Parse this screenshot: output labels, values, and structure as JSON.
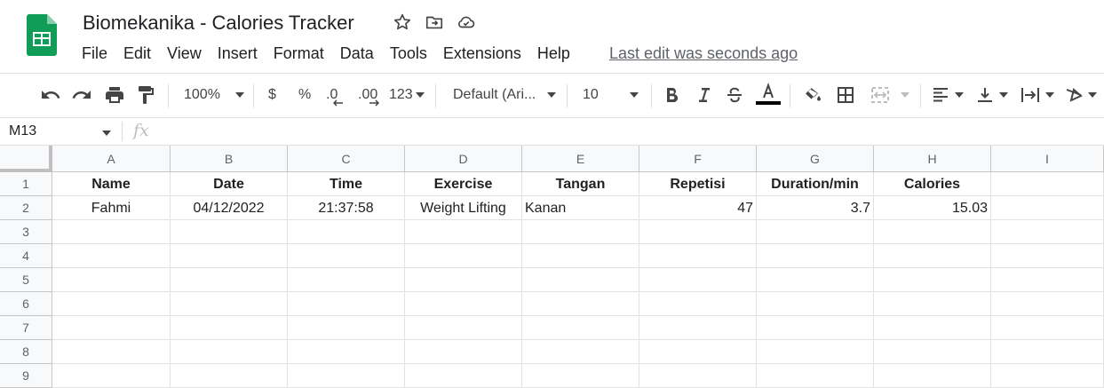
{
  "app": {
    "title": "Biomekanika - Calories Tracker",
    "last_edit": "Last edit was seconds ago",
    "brand_color": "#0F9D58"
  },
  "menu": [
    "File",
    "Edit",
    "View",
    "Insert",
    "Format",
    "Data",
    "Tools",
    "Extensions",
    "Help"
  ],
  "toolbar": {
    "zoom": "100%",
    "currency": "$",
    "percent": "%",
    "decrease_decimals": ".0",
    "increase_decimals": ".00",
    "more_formats": "123",
    "font": "Default (Ari...",
    "font_size": "10"
  },
  "formula_bar": {
    "name_box": "M13",
    "fx": "fx"
  },
  "columns": [
    "A",
    "B",
    "C",
    "D",
    "E",
    "F",
    "G",
    "H",
    "I"
  ],
  "rows": [
    "1",
    "2",
    "3",
    "4",
    "5",
    "6",
    "7",
    "8",
    "9"
  ],
  "cells": {
    "r1": [
      "Name",
      "Date",
      "Time",
      "Exercise",
      "Tangan",
      "Repetisi",
      "Duration/min",
      "Calories"
    ],
    "r2": [
      "Fahmi",
      "04/12/2022",
      "21:37:58",
      "Weight Lifting",
      "Kanan",
      "47",
      "3.7",
      "15.03"
    ]
  }
}
